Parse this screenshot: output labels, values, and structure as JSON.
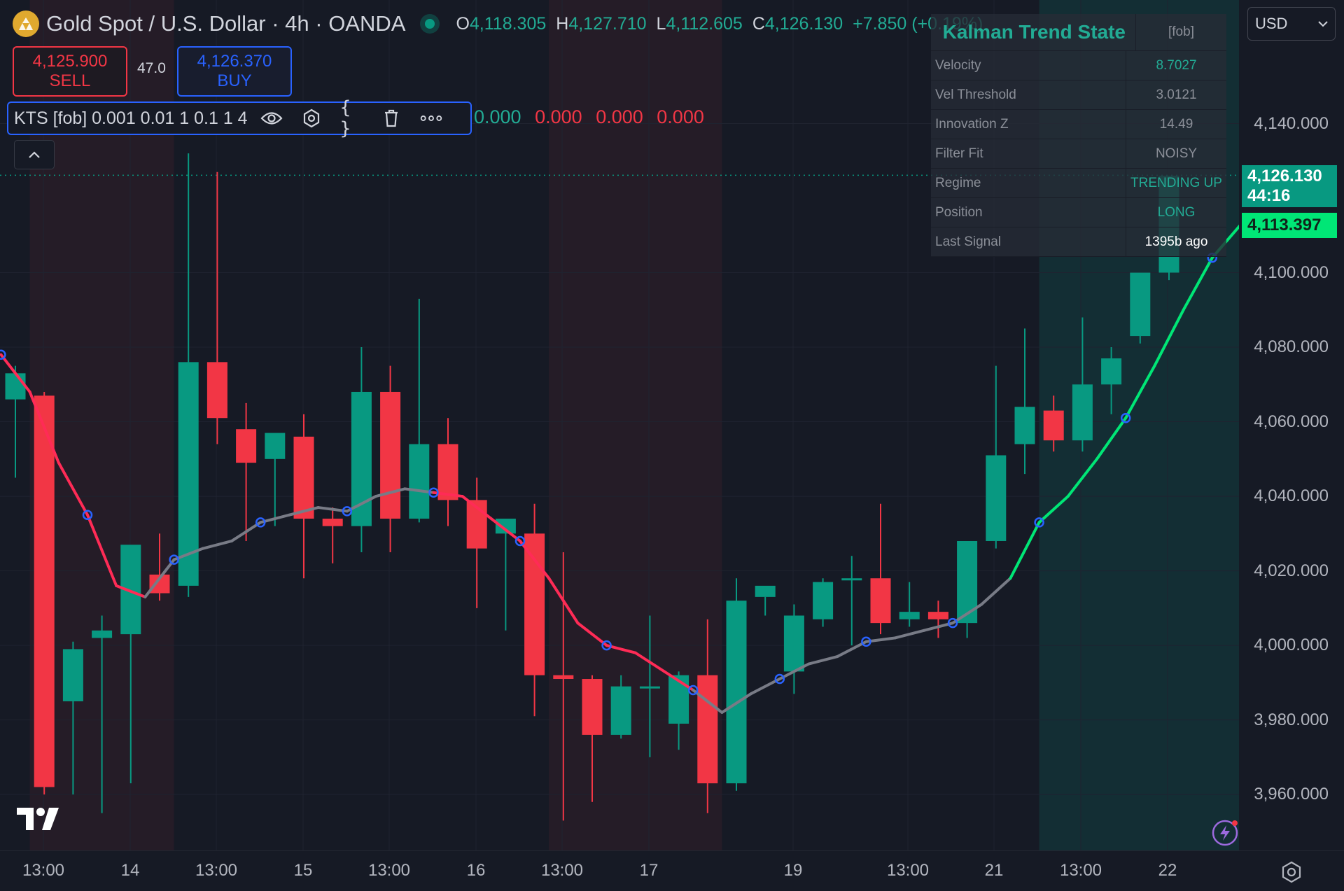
{
  "header": {
    "symbol": "Gold Spot / U.S. Dollar",
    "interval": "4h",
    "exchange": "OANDA",
    "ohlc": [
      {
        "key": "O",
        "value": "4,118.305"
      },
      {
        "key": "H",
        "value": "4,127.710"
      },
      {
        "key": "L",
        "value": "4,112.605"
      },
      {
        "key": "C",
        "value": "4,126.130"
      }
    ],
    "change": "+7.850 (+0.19%)"
  },
  "trade": {
    "sell_price": "4,125.900",
    "sell_label": "SELL",
    "spread": "47.0",
    "buy_price": "4,126.370",
    "buy_label": "BUY"
  },
  "indicator": {
    "label": "KTS [fob] 0.001 0.01 1 0.1 1 4",
    "values": [
      {
        "text": "0.000",
        "color": "#22ab94"
      },
      {
        "text": "0.000",
        "color": "#f23645"
      },
      {
        "text": "0.000",
        "color": "#f23645"
      },
      {
        "text": "0.000",
        "color": "#f23645"
      }
    ]
  },
  "table": {
    "title": "Kalman Trend State",
    "title_tag": "[fob]",
    "rows": [
      {
        "key": "Velocity",
        "value": "8.7027",
        "color": "#22ab94"
      },
      {
        "key": "Vel Threshold",
        "value": "3.0121",
        "color": "#8b8f98"
      },
      {
        "key": "Innovation Z",
        "value": "14.49",
        "color": "#8b8f98"
      },
      {
        "key": "Filter Fit",
        "value": "NOISY",
        "color": "#8b8f98"
      },
      {
        "key": "Regime",
        "value": "TRENDING UP",
        "color": "#22ab94"
      },
      {
        "key": "Position",
        "value": "LONG",
        "color": "#22ab94"
      },
      {
        "key": "Last Signal",
        "value": "1395b ago",
        "color": "#ffffff"
      }
    ]
  },
  "price_axis": {
    "currency": "USD",
    "ticks": [
      "4,140.000",
      "4,100.000",
      "4,080.000",
      "4,060.000",
      "4,040.000",
      "4,020.000",
      "4,000.000",
      "3,980.000",
      "3,960.000"
    ],
    "current_price": "4,126.130",
    "countdown": "44:16",
    "filter_price": "4,113.397"
  },
  "time_axis": {
    "ticks": [
      "13:00",
      "14",
      "13:00",
      "15",
      "13:00",
      "16",
      "13:00",
      "17",
      "19",
      "13:00",
      "21",
      "13:00",
      "22"
    ]
  },
  "colors": {
    "up": "#089981",
    "down": "#f23645",
    "background": "#161a25",
    "accent": "#2962ff"
  },
  "chart_data": {
    "type": "candlestick",
    "y_range": [
      3945,
      4160
    ],
    "candles": [
      {
        "o": 4066,
        "h": 4075,
        "l": 4045,
        "c": 4073
      },
      {
        "o": 4067,
        "h": 4068,
        "l": 3960,
        "c": 3962
      },
      {
        "o": 3985,
        "h": 4001,
        "l": 3960,
        "c": 3999
      },
      {
        "o": 4002,
        "h": 4008,
        "l": 3955,
        "c": 4004
      },
      {
        "o": 4003,
        "h": 4025,
        "l": 3963,
        "c": 4027
      },
      {
        "o": 4019,
        "h": 4030,
        "l": 4012,
        "c": 4014
      },
      {
        "o": 4016,
        "h": 4132,
        "l": 4013,
        "c": 4076
      },
      {
        "o": 4076,
        "h": 4127,
        "l": 4054,
        "c": 4061
      },
      {
        "o": 4058,
        "h": 4065,
        "l": 4028,
        "c": 4049
      },
      {
        "o": 4050,
        "h": 4052,
        "l": 4032,
        "c": 4057
      },
      {
        "o": 4056,
        "h": 4062,
        "l": 4018,
        "c": 4034
      },
      {
        "o": 4034,
        "h": 4037,
        "l": 4022,
        "c": 4032
      },
      {
        "o": 4032,
        "h": 4080,
        "l": 4025,
        "c": 4068
      },
      {
        "o": 4068,
        "h": 4075,
        "l": 4025,
        "c": 4034
      },
      {
        "o": 4034,
        "h": 4093,
        "l": 4033,
        "c": 4054
      },
      {
        "o": 4054,
        "h": 4061,
        "l": 4032,
        "c": 4039
      },
      {
        "o": 4039,
        "h": 4045,
        "l": 4010,
        "c": 4026
      },
      {
        "o": 4030,
        "h": 4032,
        "l": 4004,
        "c": 4034
      },
      {
        "o": 4030,
        "h": 4038,
        "l": 3981,
        "c": 3992
      },
      {
        "o": 3992,
        "h": 4025,
        "l": 3953,
        "c": 3991
      },
      {
        "o": 3991,
        "h": 3992,
        "l": 3958,
        "c": 3976
      },
      {
        "o": 3976,
        "h": 3992,
        "l": 3975,
        "c": 3989
      },
      {
        "o": 3989,
        "h": 4008,
        "l": 3970,
        "c": 3989
      },
      {
        "o": 3979,
        "h": 3993,
        "l": 3972,
        "c": 3992
      },
      {
        "o": 3992,
        "h": 4007,
        "l": 3955,
        "c": 3963
      },
      {
        "o": 3963,
        "h": 4018,
        "l": 3961,
        "c": 4012
      },
      {
        "o": 4013,
        "h": 4013,
        "l": 4008,
        "c": 4016
      },
      {
        "o": 3993,
        "h": 4011,
        "l": 3987,
        "c": 4008
      },
      {
        "o": 4007,
        "h": 4018,
        "l": 4005,
        "c": 4017
      },
      {
        "o": 4018,
        "h": 4024,
        "l": 4000,
        "c": 4018
      },
      {
        "o": 4018,
        "h": 4038,
        "l": 4003,
        "c": 4006
      },
      {
        "o": 4007,
        "h": 4017,
        "l": 4005,
        "c": 4009
      },
      {
        "o": 4009,
        "h": 4012,
        "l": 4002,
        "c": 4007
      },
      {
        "o": 4006,
        "h": 4022,
        "l": 4002,
        "c": 4028
      },
      {
        "o": 4028,
        "h": 4075,
        "l": 4026,
        "c": 4051
      },
      {
        "o": 4054,
        "h": 4085,
        "l": 4046,
        "c": 4064
      },
      {
        "o": 4063,
        "h": 4067,
        "l": 4052,
        "c": 4055
      },
      {
        "o": 4055,
        "h": 4088,
        "l": 4052,
        "c": 4070
      },
      {
        "o": 4070,
        "h": 4080,
        "l": 4062,
        "c": 4077
      },
      {
        "o": 4083,
        "h": 4099,
        "l": 4081,
        "c": 4100
      },
      {
        "o": 4100,
        "h": 4126,
        "l": 4098,
        "c": 4126
      }
    ],
    "filter_line": [
      4078,
      4068,
      4049,
      4035,
      4016,
      4013,
      4023,
      4026,
      4028,
      4033,
      4035,
      4037,
      4036,
      4040,
      4042,
      4041,
      4040,
      4034,
      4028,
      4018,
      4006,
      4000,
      3998,
      3993,
      3988,
      3982,
      3987,
      3991,
      3995,
      3997,
      4001,
      4002,
      4004,
      4006,
      4011,
      4018,
      4033,
      4040,
      4050,
      4061,
      4075,
      4090,
      4104,
      4113
    ],
    "regime_bands": [
      {
        "from": 1,
        "to": 6,
        "type": "down"
      },
      {
        "from": 19,
        "to": 25,
        "type": "down"
      },
      {
        "from": 36,
        "to": 43,
        "type": "up"
      }
    ]
  }
}
